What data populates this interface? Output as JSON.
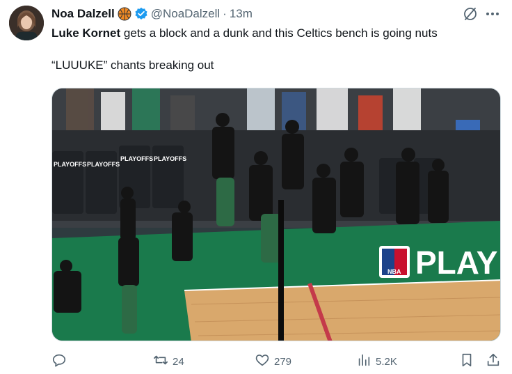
{
  "author": {
    "display_name": "Noa Dalzell",
    "handle": "@NoaDalzell",
    "separator": "·",
    "time": "13m",
    "badge_icons": [
      "basketball-icon",
      "verified-badge-icon"
    ]
  },
  "tweet": {
    "mention": "Luke Kornet",
    "line1_rest": " gets a block and a dunk and this Celtics bench is going nuts",
    "line2": "“LUUUKE” chants breaking out"
  },
  "media": {
    "banner_text": "PLAY",
    "sign_text": "PLAYOFFS",
    "logo_text": "NBA"
  },
  "actions": {
    "reply_icon": "reply-icon",
    "retweet_count": "24",
    "like_count": "279",
    "views_count": "5.2K",
    "bookmark_icon": "bookmark-icon",
    "share_icon": "share-icon"
  },
  "colors": {
    "verified": "#1d9bf0",
    "secondary_text": "#536471",
    "court_green": "#1a7a4c",
    "floor_wood": "#d9a86c"
  }
}
